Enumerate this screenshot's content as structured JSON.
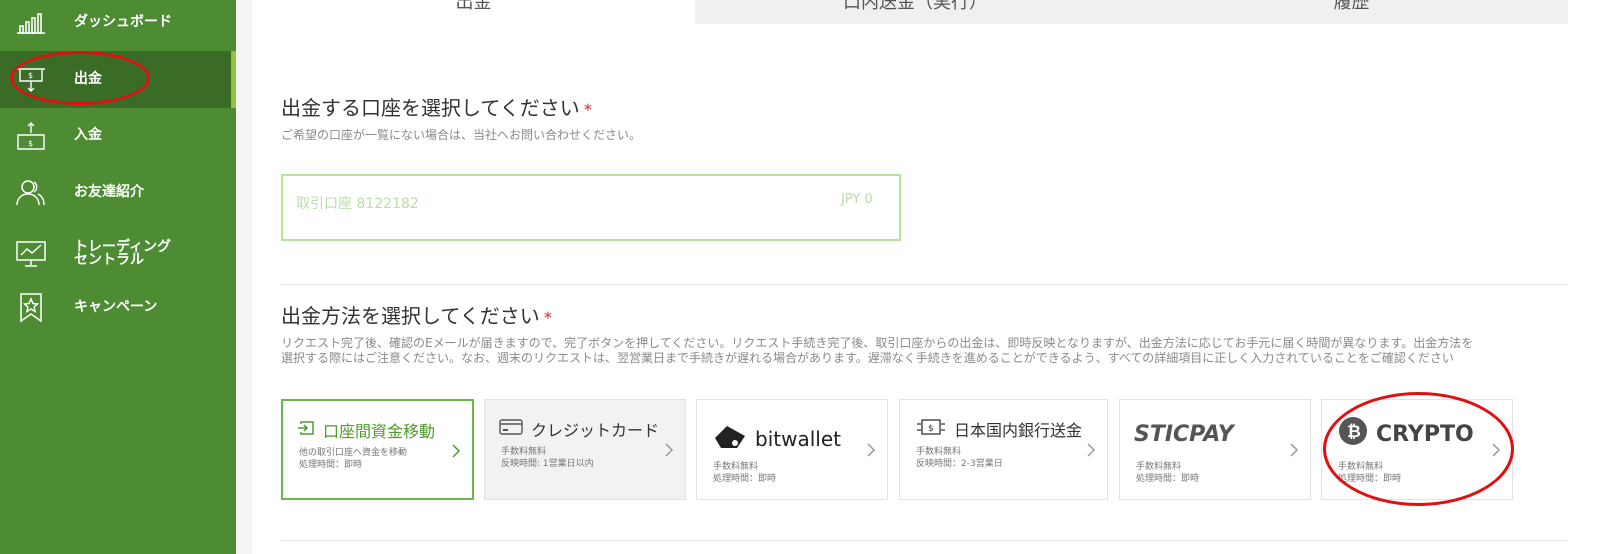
{
  "sidebar": {
    "items": [
      {
        "label": "ダッシュボード",
        "icon": "bar-chart-icon"
      },
      {
        "label": "出金",
        "icon": "withdraw-icon"
      },
      {
        "label": "入金",
        "icon": "deposit-icon"
      },
      {
        "label": "お友達紹介",
        "icon": "users-icon"
      },
      {
        "label": "トレーディング",
        "label2": "セントラル",
        "icon": "monitor-chart-icon"
      },
      {
        "label": "キャンペーン",
        "icon": "star-bookmark-icon"
      }
    ]
  },
  "tabs": [
    {
      "label": "出金"
    },
    {
      "label": "口内送金（実行）"
    },
    {
      "label": "履歴"
    }
  ],
  "account_section": {
    "title": "出金する口座を選択してください",
    "required": "*",
    "subtitle": "ご希望の口座が一覧にない場合は、当社へお問い合わせください。",
    "account_name": "取引口座 8122182",
    "account_balance": "JPY 0"
  },
  "method_section": {
    "title": "出金方法を選択してください",
    "required": "*",
    "note_line1": "リクエスト完了後、確認のEメールが届きますので、完了ボタンを押してください。リクエスト手続き完了後、取引口座からの出金は、即時反映となりますが、出金方法に応じてお手元に届く時間が異なります。出金方法を",
    "note_line2": "選択する際にはご注意ください。なお、週末のリクエストは、翌営業日まで手続きが遅れる場合があります。遅滞なく手続きを進めることができるよう、すべての詳細項目に正しく入力されていることをご確認ください"
  },
  "methods": [
    {
      "title": "口座間資金移動",
      "line1": "他の取引口座へ資金を移動",
      "line2": "処理時間：即時",
      "icon": "transfer-icon"
    },
    {
      "title": "クレジットカード",
      "line1": "手数料無料",
      "line2": "反映時間: 1営業日以内",
      "icon": "credit-card-icon"
    },
    {
      "title": "bitwallet",
      "line1": "手数料無料",
      "line2": "処理時間：即時",
      "icon": "bitwallet-logo-icon"
    },
    {
      "title": "日本国内銀行送金",
      "line1": "手数料無料",
      "line2": "反映時間：2-3営業日",
      "icon": "bank-transfer-icon"
    },
    {
      "title": "STICPAY",
      "line1": "手数料無料",
      "line2": "処理時間：即時",
      "icon": "sticpay-logo"
    },
    {
      "title": "CRYPTO",
      "line1": "手数料無料",
      "line2": "処理時間：即時",
      "icon": "bitcoin-icon"
    }
  ],
  "colors": {
    "sidebar": "#4d8c32",
    "sidebar_active": "#3a6b27",
    "accent_green": "#6cb74b",
    "annotation_red": "#e01010"
  }
}
